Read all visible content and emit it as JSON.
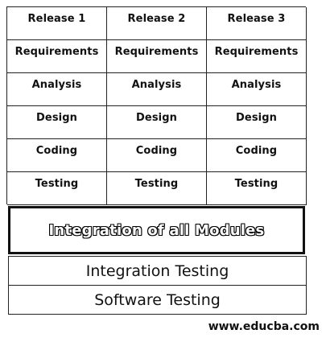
{
  "releases": [
    {
      "header": "Release 1",
      "phases": [
        "Requirements",
        "Analysis",
        "Design",
        "Coding",
        "Testing"
      ]
    },
    {
      "header": "Release 2",
      "phases": [
        "Requirements",
        "Analysis",
        "Design",
        "Coding",
        "Testing"
      ]
    },
    {
      "header": "Release 3",
      "phases": [
        "Requirements",
        "Analysis",
        "Design",
        "Coding",
        "Testing"
      ]
    }
  ],
  "integration_box": {
    "label": "Integration of all Modules"
  },
  "bottom_bars": [
    "Integration Testing",
    "Software Testing"
  ],
  "footer": {
    "site": "www.educba.com"
  },
  "colors": {
    "line": "#222222",
    "text": "#111111",
    "background": "#ffffff"
  }
}
